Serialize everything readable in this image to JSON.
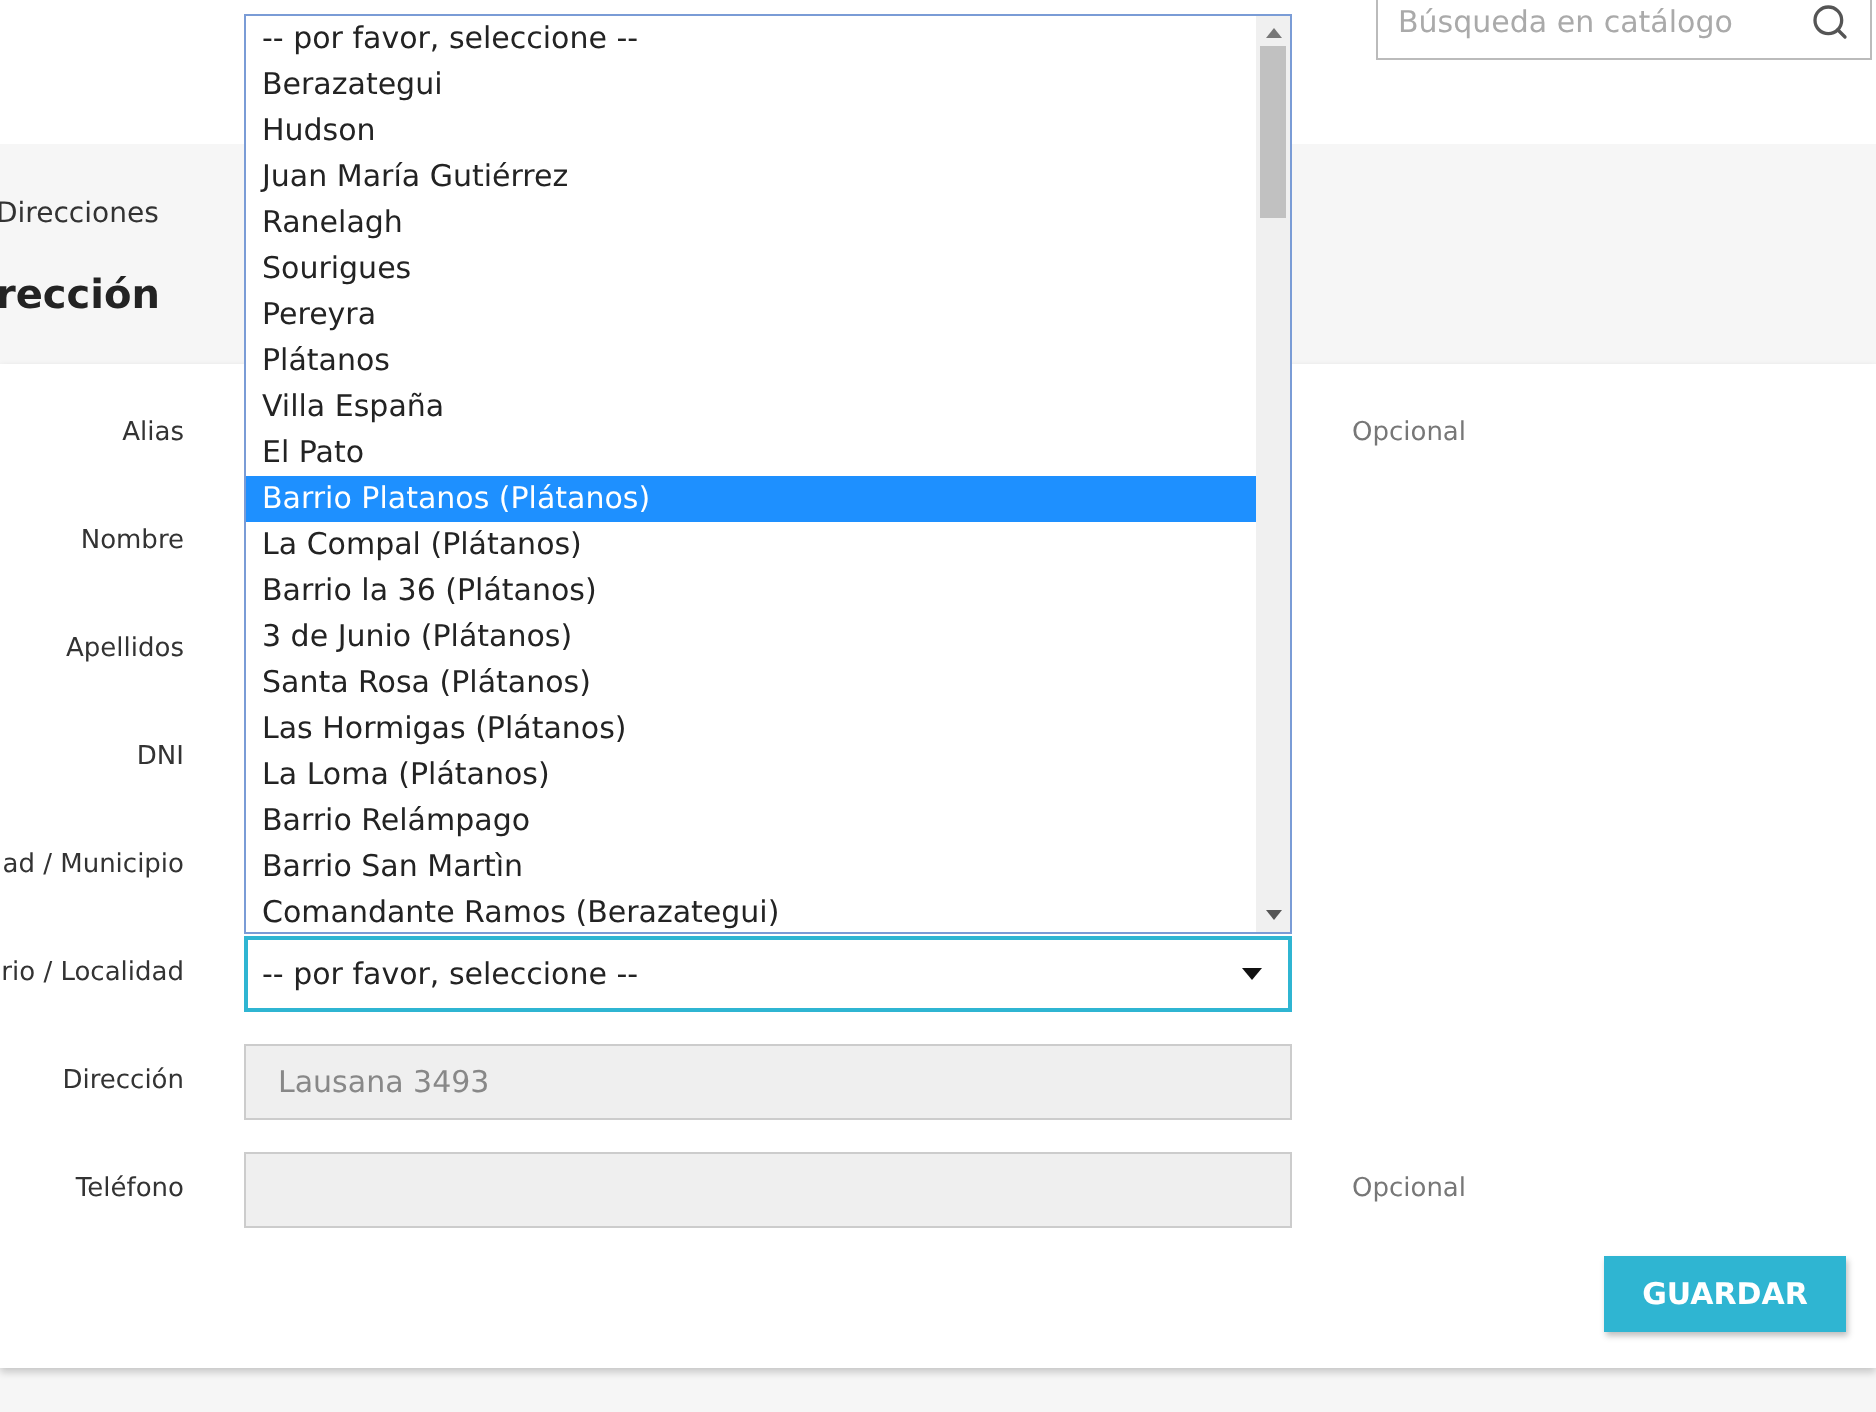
{
  "header": {
    "search": {
      "placeholder": "Búsqueda en catálogo"
    }
  },
  "breadcrumb": "Direcciones",
  "heading": "rección",
  "form": {
    "rows": [
      {
        "label": "Alias",
        "note": "Opcional"
      },
      {
        "label": "Nombre"
      },
      {
        "label": "Apellidos"
      },
      {
        "label": "DNI"
      },
      {
        "label": "ad / Municipio"
      },
      {
        "label": "rio / Localidad",
        "field": {
          "kind": "select",
          "value": "-- por favor, seleccione --"
        }
      },
      {
        "label": "Dirección",
        "field": {
          "kind": "input",
          "placeholder": "Lausana 3493"
        }
      },
      {
        "label": "Teléfono",
        "field": {
          "kind": "input"
        },
        "note": "Opcional"
      }
    ],
    "submit": "GUARDAR"
  },
  "dropdown": {
    "options": [
      {
        "label": "-- por favor, seleccione --",
        "selected": false
      },
      {
        "label": "Berazategui",
        "selected": false
      },
      {
        "label": "Hudson",
        "selected": false
      },
      {
        "label": "Juan María Gutiérrez",
        "selected": false
      },
      {
        "label": "Ranelagh",
        "selected": false
      },
      {
        "label": "Sourigues",
        "selected": false
      },
      {
        "label": "Pereyra",
        "selected": false
      },
      {
        "label": "Plátanos",
        "selected": false
      },
      {
        "label": "Villa España",
        "selected": false
      },
      {
        "label": "El Pato",
        "selected": false
      },
      {
        "label": "Barrio Platanos (Plátanos)",
        "selected": true
      },
      {
        "label": "La Compal (Plátanos)",
        "selected": false
      },
      {
        "label": "Barrio la 36 (Plátanos)",
        "selected": false
      },
      {
        "label": "3 de Junio (Plátanos)",
        "selected": false
      },
      {
        "label": "Santa Rosa (Plátanos)",
        "selected": false
      },
      {
        "label": "Las Hormigas (Plátanos)",
        "selected": false
      },
      {
        "label": "La Loma (Plátanos)",
        "selected": false
      },
      {
        "label": "Barrio Relámpago",
        "selected": false
      },
      {
        "label": "Barrio San Martìn",
        "selected": false
      },
      {
        "label": "Comandante Ramos (Berazategui)",
        "selected": false
      }
    ]
  }
}
